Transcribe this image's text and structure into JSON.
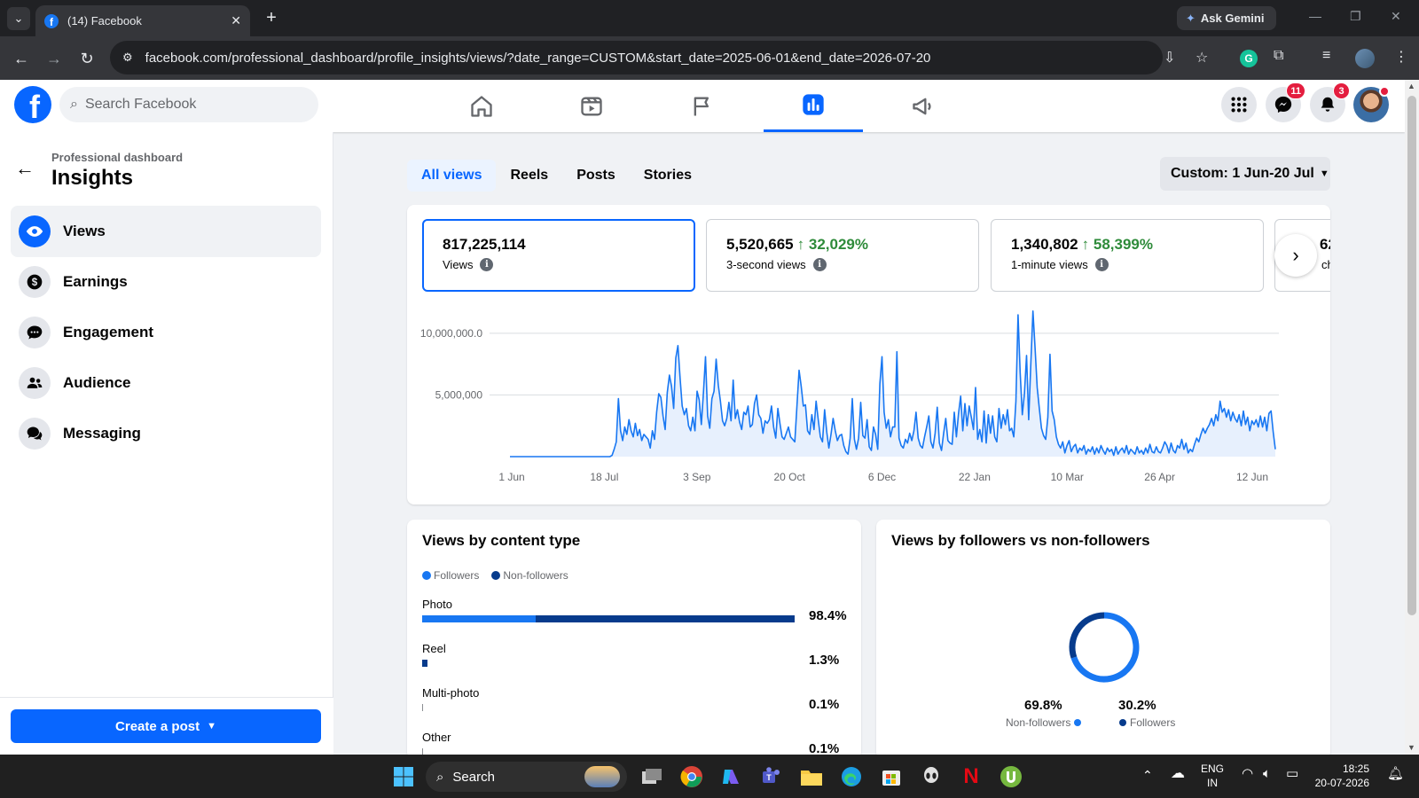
{
  "browser": {
    "tab_title": "(14) Facebook",
    "url": "facebook.com/professional_dashboard/profile_insights/views/?date_range=CUSTOM&start_date=2025-06-01&end_date=2026-07-20",
    "ask_gemini": "Ask Gemini"
  },
  "fb": {
    "search_placeholder": "Search Facebook",
    "messenger_badge": "11",
    "notifications_badge": "3"
  },
  "sidebar": {
    "breadcrumb": "Professional dashboard",
    "title": "Insights",
    "items": [
      {
        "label": "Views",
        "icon": "eye-icon"
      },
      {
        "label": "Earnings",
        "icon": "dollar-icon"
      },
      {
        "label": "Engagement",
        "icon": "chat-icon"
      },
      {
        "label": "Audience",
        "icon": "people-icon"
      },
      {
        "label": "Messaging",
        "icon": "messages-icon"
      }
    ],
    "create_post": "Create a post"
  },
  "main": {
    "tabs": [
      "All views",
      "Reels",
      "Posts",
      "Stories"
    ],
    "date_range": "Custom: 1 Jun-20 Jul",
    "metrics": [
      {
        "value": "817,225,114",
        "delta": "",
        "label": "Views"
      },
      {
        "value": "5,520,665",
        "delta": "↑ 32,029%",
        "label": "3-second views"
      },
      {
        "value": "1,340,802",
        "delta": "↑ 58,399%",
        "label": "1-minute views"
      }
    ],
    "metric_partial": {
      "value": "62",
      "label": "ch"
    }
  },
  "chart_data": {
    "type": "area",
    "title": "",
    "xlabel": "",
    "ylabel": "",
    "x_ticks": [
      "1 Jun",
      "18 Jul",
      "3 Sep",
      "20 Oct",
      "6 Dec",
      "22 Jan",
      "10 Mar",
      "26 Apr",
      "12 Jun"
    ],
    "y_ticks": [
      "5,000,000",
      "10,000,000.0"
    ],
    "ylim": [
      0,
      12000000
    ],
    "color": "#1877f2",
    "fill": "#e7f0fd",
    "series": [
      {
        "values": [
          0,
          0,
          0,
          0,
          0,
          0,
          0,
          0,
          0,
          0,
          0,
          0,
          0,
          0,
          0,
          0,
          0,
          0,
          0,
          0,
          0,
          0,
          0,
          0,
          0,
          0,
          0,
          0,
          0,
          0,
          0,
          0,
          0,
          0,
          0,
          0,
          0,
          0,
          0,
          0,
          0,
          0,
          0,
          0,
          0,
          0,
          0,
          0,
          100000,
          600000,
          1200000,
          4700000,
          2100000,
          1300000,
          2400000,
          1800000,
          3000000,
          2100000,
          1600000,
          2700000,
          1700000,
          2200000,
          1300000,
          1800000,
          1600000,
          1400000,
          700000,
          2100000,
          1400000,
          3600000,
          5100000,
          4800000,
          3300000,
          2200000,
          5200000,
          6600000,
          5700000,
          3900000,
          8000000,
          9000000,
          6400000,
          4100000,
          3400000,
          3900000,
          2500000,
          2100000,
          3200000,
          2100000,
          5300000,
          4600000,
          2600000,
          5100000,
          8100000,
          3300000,
          2300000,
          4700000,
          5300000,
          7900000,
          5800000,
          4500000,
          2900000,
          2500000,
          3100000,
          4400000,
          2900000,
          6200000,
          3100000,
          3800000,
          2800000,
          2200000,
          3600000,
          3400000,
          4100000,
          2400000,
          2600000,
          4300000,
          5000000,
          3400000,
          3100000,
          1900000,
          2900000,
          2700000,
          3000000,
          4100000,
          2400000,
          1500000,
          3900000,
          2700000,
          1600000,
          1400000,
          1900000,
          2400000,
          1600000,
          1400000,
          1200000,
          4100000,
          7000000,
          5700000,
          4100000,
          4200000,
          2100000,
          1800000,
          3400000,
          2200000,
          4500000,
          3000000,
          1600000,
          1200000,
          3800000,
          2000000,
          700000,
          1800000,
          3100000,
          2100000,
          1300000,
          1700000,
          1800000,
          900000,
          400000,
          200000,
          1500000,
          4700000,
          1400000,
          600000,
          1500000,
          4400000,
          1700000,
          1500000,
          3000000,
          800000,
          500000,
          2400000,
          1800000,
          600000,
          5900000,
          8100000,
          3600000,
          2300000,
          3000000,
          1600000,
          2400000,
          2400000,
          8500000,
          1500000,
          900000,
          700000,
          1400000,
          1100000,
          1900000,
          1300000,
          2100000,
          3600000,
          1500000,
          900000,
          700000,
          1600000,
          2400000,
          3300000,
          1200000,
          700000,
          1900000,
          4000000,
          1100000,
          500000,
          1900000,
          3100000,
          1300000,
          1100000,
          1000000,
          3600000,
          1600000,
          3500000,
          4900000,
          2100000,
          4300000,
          2500000,
          4100000,
          3200000,
          2200000,
          5600000,
          1400000,
          2200000,
          1200000,
          3700000,
          1100000,
          3400000,
          1900000,
          3300000,
          1600000,
          1200000,
          3900000,
          2300000,
          3400000,
          2600000,
          3800000,
          2100000,
          2300000,
          1600000,
          4500000,
          11500000,
          6800000,
          3400000,
          5100000,
          8200000,
          3000000,
          7500000,
          11800000,
          8800000,
          5600000,
          3900000,
          2300000,
          1700000,
          1400000,
          3200000,
          8300000,
          3700000,
          3000000,
          1600000,
          1000000,
          700000,
          1200000,
          300000,
          900000,
          1300000,
          400000,
          800000,
          1000000,
          300000,
          700000,
          500000,
          900000,
          200000,
          600000,
          400000,
          800000,
          200000,
          700000,
          300000,
          900000,
          500000,
          200000,
          700000,
          400000,
          600000,
          100000,
          800000,
          200000,
          500000,
          700000,
          300000,
          900000,
          200000,
          600000,
          400000,
          200000,
          800000,
          300000,
          500000,
          200000,
          700000,
          300000,
          1000000,
          400000,
          300000,
          800000,
          400000,
          300000,
          700000,
          1200000,
          900000,
          300000,
          1100000,
          500000,
          300000,
          900000,
          700000,
          1400000,
          600000,
          1100000,
          300000,
          600000,
          400000,
          1000000,
          1500000,
          1200000,
          1800000,
          2300000,
          1900000,
          2300000,
          2600000,
          3100000,
          2500000,
          3400000,
          2900000,
          4500000,
          3600000,
          3900000,
          3200000,
          3800000,
          2900000,
          3600000,
          3100000,
          2800000,
          3400000,
          2500000,
          3700000,
          2600000,
          3200000,
          2100000,
          2900000,
          2600000,
          3000000,
          2400000,
          3300000,
          2400000,
          3200000,
          2100000,
          3500000,
          3700000,
          2000000,
          600000
        ]
      }
    ],
    "notes": "values estimated from rendered line"
  },
  "content_type": {
    "title": "Views by content type",
    "legend": [
      "Followers",
      "Non-followers"
    ],
    "colors": {
      "followers": "#1877f2",
      "non_followers": "#073b8c"
    },
    "rows": [
      {
        "label": "Photo",
        "pct": "98.4%",
        "followers_share": 0.304,
        "value": 0.984
      },
      {
        "label": "Reel",
        "pct": "1.3%",
        "followers_share": 0.0,
        "value": 0.013
      },
      {
        "label": "Multi-photo",
        "pct": "0.1%",
        "followers_share": 0.0,
        "value": 0.001
      },
      {
        "label": "Other",
        "pct": "0.1%",
        "followers_share": 0.0,
        "value": 0.001
      }
    ]
  },
  "followers_split": {
    "title": "Views by followers vs non-followers",
    "non_followers_pct": "69.8%",
    "non_followers_label": "Non-followers",
    "followers_pct": "30.2%",
    "followers_label": "Followers",
    "non_followers_value": 69.8,
    "followers_value": 30.2
  },
  "taskbar": {
    "search": "Search",
    "lang_line1": "ENG",
    "lang_line2": "IN",
    "time": "18:25",
    "date": "20-07-2026"
  }
}
